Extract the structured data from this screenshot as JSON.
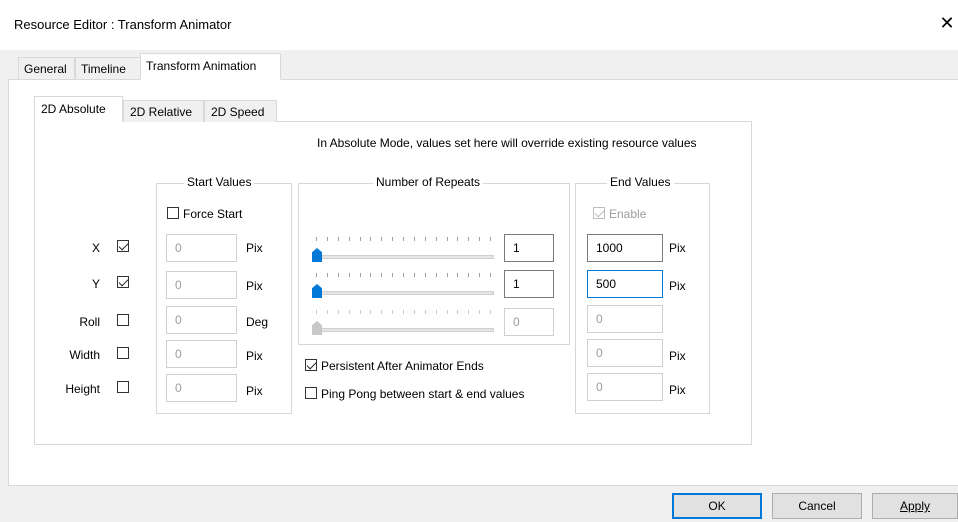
{
  "window": {
    "title": "Resource Editor  :  Transform Animator",
    "close_glyph": "✕"
  },
  "tabs": [
    {
      "label": "General"
    },
    {
      "label": "Timeline"
    },
    {
      "label": "Transform Animation"
    }
  ],
  "subtabs": [
    {
      "label": "2D Absolute"
    },
    {
      "label": "2D Relative"
    },
    {
      "label": "2D Speed"
    }
  ],
  "info_text": "In Absolute Mode, values set here will override existing resource values",
  "rows": [
    {
      "label": "X",
      "checked": true
    },
    {
      "label": "Y",
      "checked": true
    },
    {
      "label": "Roll",
      "checked": false
    },
    {
      "label": "Width",
      "checked": false
    },
    {
      "label": "Height",
      "checked": false
    }
  ],
  "start_values": {
    "title": "Start Values",
    "force_start_label": "Force Start",
    "values": [
      "0",
      "0",
      "0",
      "0",
      "0"
    ],
    "units": [
      "Pix",
      "Pix",
      "Deg",
      "Pix",
      "Pix"
    ]
  },
  "repeats": {
    "title": "Number of Repeats",
    "values": [
      "1",
      "1",
      "0"
    ],
    "persistent_label": "Persistent After Animator Ends",
    "pingpong_label": "Ping Pong between start & end values"
  },
  "end_values": {
    "title": "End Values",
    "enable_label": "Enable",
    "values": [
      "1000",
      "500",
      "0",
      "0",
      "0"
    ],
    "units": [
      "Pix",
      "Pix",
      "",
      "Pix",
      "Pix"
    ]
  },
  "buttons": {
    "ok": "OK",
    "cancel": "Cancel",
    "apply": "Apply"
  }
}
